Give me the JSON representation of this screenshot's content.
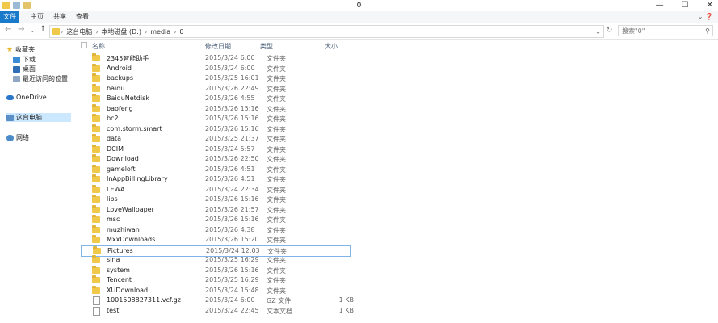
{
  "window": {
    "title": "0",
    "minimize": "—",
    "maximize": "☐",
    "close": "✕"
  },
  "ribbon": {
    "tabs": [
      "文件",
      "主页",
      "共享",
      "查看"
    ],
    "expand": "⌄ ❓"
  },
  "address": {
    "back": "←",
    "forward": "→",
    "recent": "⌄",
    "up": "↑",
    "path": [
      "这台电脑",
      "本地磁盘 (D:)",
      "media",
      "0"
    ],
    "dropdown": "⌄",
    "refresh": "↻",
    "search_placeholder": "搜索\"0\"",
    "search_icon": "⚲"
  },
  "sidebar": {
    "favorites": "收藏夹",
    "favorites_items": [
      "下载",
      "桌面",
      "最近访问的位置"
    ],
    "onedrive": "OneDrive",
    "thispc": "这台电脑",
    "network": "网络"
  },
  "columns": {
    "name": "名称",
    "date": "修改日期",
    "type": "类型",
    "size": "大小"
  },
  "rows": [
    {
      "name": "2345智能助手",
      "date": "2015/3/24 6:00",
      "type": "文件夹",
      "size": "",
      "kind": "folder"
    },
    {
      "name": "Android",
      "date": "2015/3/24 6:00",
      "type": "文件夹",
      "size": "",
      "kind": "folder"
    },
    {
      "name": "backups",
      "date": "2015/3/25 16:01",
      "type": "文件夹",
      "size": "",
      "kind": "folder"
    },
    {
      "name": "baidu",
      "date": "2015/3/26 22:49",
      "type": "文件夹",
      "size": "",
      "kind": "folder"
    },
    {
      "name": "BaiduNetdisk",
      "date": "2015/3/26 4:55",
      "type": "文件夹",
      "size": "",
      "kind": "folder"
    },
    {
      "name": "baofeng",
      "date": "2015/3/26 15:16",
      "type": "文件夹",
      "size": "",
      "kind": "folder"
    },
    {
      "name": "bc2",
      "date": "2015/3/26 15:16",
      "type": "文件夹",
      "size": "",
      "kind": "folder"
    },
    {
      "name": "com.storm.smart",
      "date": "2015/3/26 15:16",
      "type": "文件夹",
      "size": "",
      "kind": "folder"
    },
    {
      "name": "data",
      "date": "2015/3/25 21:37",
      "type": "文件夹",
      "size": "",
      "kind": "folder"
    },
    {
      "name": "DCIM",
      "date": "2015/3/24 5:57",
      "type": "文件夹",
      "size": "",
      "kind": "folder"
    },
    {
      "name": "Download",
      "date": "2015/3/26 22:50",
      "type": "文件夹",
      "size": "",
      "kind": "folder"
    },
    {
      "name": "gameloft",
      "date": "2015/3/26 4:51",
      "type": "文件夹",
      "size": "",
      "kind": "folder"
    },
    {
      "name": "InAppBillingLibrary",
      "date": "2015/3/26 4:51",
      "type": "文件夹",
      "size": "",
      "kind": "folder"
    },
    {
      "name": "LEWA",
      "date": "2015/3/24 22:34",
      "type": "文件夹",
      "size": "",
      "kind": "folder"
    },
    {
      "name": "libs",
      "date": "2015/3/26 15:16",
      "type": "文件夹",
      "size": "",
      "kind": "folder"
    },
    {
      "name": "LoveWallpaper",
      "date": "2015/3/26 21:57",
      "type": "文件夹",
      "size": "",
      "kind": "folder"
    },
    {
      "name": "msc",
      "date": "2015/3/26 15:16",
      "type": "文件夹",
      "size": "",
      "kind": "folder"
    },
    {
      "name": "muzhiwan",
      "date": "2015/3/26 4:38",
      "type": "文件夹",
      "size": "",
      "kind": "folder"
    },
    {
      "name": "MxxDownloads",
      "date": "2015/3/26 15:20",
      "type": "文件夹",
      "size": "",
      "kind": "folder"
    },
    {
      "name": "Pictures",
      "date": "2015/3/24 12:03",
      "type": "文件夹",
      "size": "",
      "kind": "folder",
      "selected": true
    },
    {
      "name": "sina",
      "date": "2015/3/25 16:29",
      "type": "文件夹",
      "size": "",
      "kind": "folder"
    },
    {
      "name": "system",
      "date": "2015/3/26 15:16",
      "type": "文件夹",
      "size": "",
      "kind": "folder"
    },
    {
      "name": "Tencent",
      "date": "2015/3/25 16:29",
      "type": "文件夹",
      "size": "",
      "kind": "folder"
    },
    {
      "name": "XUDownload",
      "date": "2015/3/24 15:48",
      "type": "文件夹",
      "size": "",
      "kind": "folder"
    },
    {
      "name": "1001508827311.vcf.gz",
      "date": "2015/3/24 6:00",
      "type": "GZ 文件",
      "size": "1 KB",
      "kind": "file"
    },
    {
      "name": "test",
      "date": "2015/3/24 22:45",
      "type": "文本文档",
      "size": "1 KB",
      "kind": "file"
    }
  ]
}
